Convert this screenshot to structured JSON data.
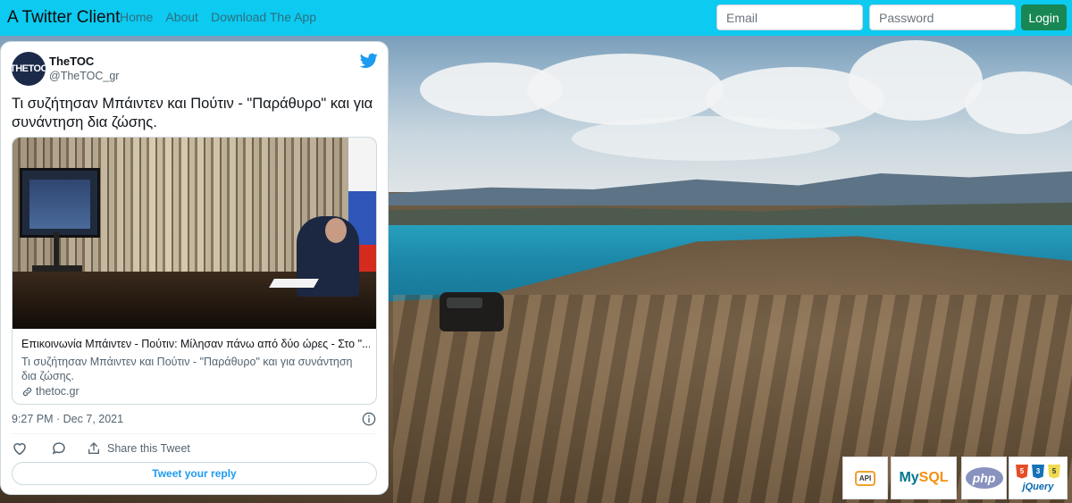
{
  "navbar": {
    "brand": "A Twitter Client",
    "links": [
      "Home",
      "About",
      "Download The App"
    ],
    "email_placeholder": "Email",
    "password_placeholder": "Password",
    "login_label": "Login",
    "color": "#0dcaf0"
  },
  "tweet": {
    "avatar_text": "THETOC",
    "display_name": "TheTOC",
    "handle": "@TheTOC_gr",
    "text": "Τι συζήτησαν Μπάιντεν και Πούτιν - \"Παράθυρο\" και για συνάντηση δια ζώσης.",
    "card": {
      "title": "Επικοινωνία Μπάιντεν - Πούτιν: Μίλησαν πάνω από δύο ώρες - Στο \"...",
      "description": "Τι συζήτησαν Μπάιντεν και Πούτιν - \"Παράθυρο\" και για συνάντηση δια ζώσης.",
      "domain": "thetoc.gr"
    },
    "timestamp": "9:27 PM · Dec 7, 2021",
    "share_label": "Share this Tweet",
    "reply_label": "Tweet your reply",
    "accent": "#1d9bf0"
  },
  "logos": {
    "api": "API",
    "mysql_my": "My",
    "mysql_sql": "SQL",
    "php": "php",
    "html": "5",
    "css": "3",
    "js": "5",
    "jquery": "jQuery"
  }
}
